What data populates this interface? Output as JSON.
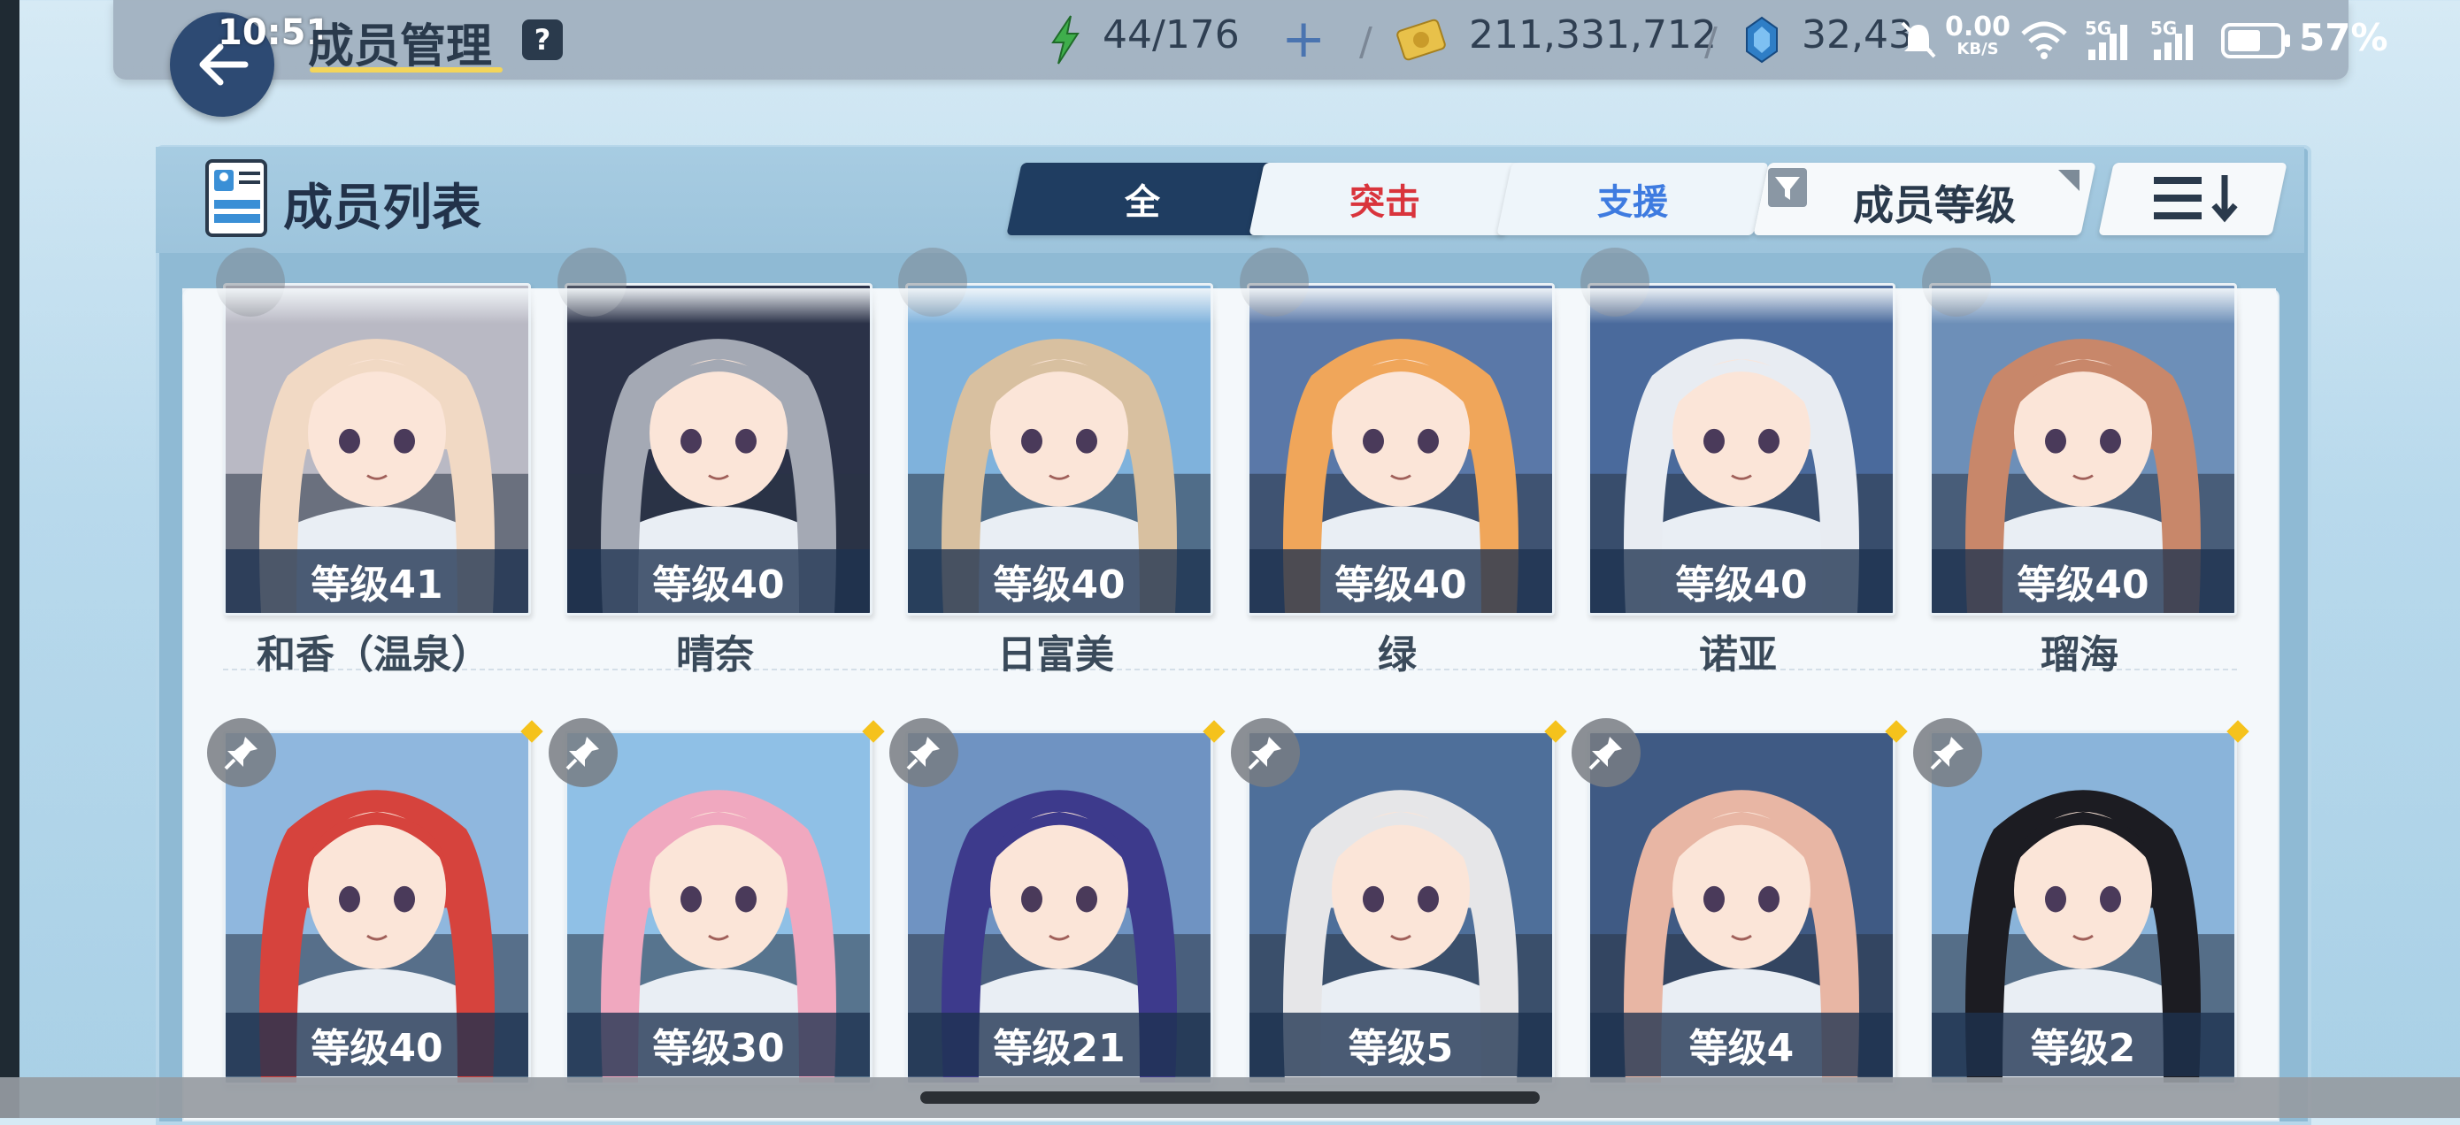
{
  "status_bar": {
    "time": "10:51",
    "net_speed_value": "0.00",
    "net_speed_unit": "KB/S",
    "signal1_label": "5G",
    "signal2_label": "5G",
    "battery": "57%"
  },
  "header": {
    "title": "成员管理",
    "help_label": "?",
    "ap": "44/176",
    "credits": "211,331,712",
    "pyroxene": "32,43"
  },
  "panel": {
    "title": "成员列表",
    "tabs": [
      {
        "label": "全",
        "selected": true
      },
      {
        "label": "突击",
        "color": "#d9343c"
      },
      {
        "label": "支援",
        "color": "#3e7be0"
      }
    ],
    "sort_label": "成员等级"
  },
  "students": [
    {
      "name": "和香（温泉）",
      "level": "等级41",
      "hair": "#f1d9c4",
      "bg": "#b9b9c4"
    },
    {
      "name": "晴奈",
      "level": "等级40",
      "hair": "#a4a9b4",
      "bg": "#2b3248"
    },
    {
      "name": "日富美",
      "level": "等级40",
      "hair": "#d8c0a0",
      "bg": "#7fb2dc"
    },
    {
      "name": "绿",
      "level": "等级40",
      "hair": "#f0a65a",
      "bg": "#5a78a8"
    },
    {
      "name": "诺亚",
      "level": "等级40",
      "hair": "#e8ecf2",
      "bg": "#4a6a9c"
    },
    {
      "name": "瑠海",
      "level": "等级40",
      "hair": "#c8876a",
      "bg": "#6d8fb8"
    },
    {
      "level": "等级40",
      "hair": "#d6433d",
      "bg": "#8fb7de"
    },
    {
      "level": "等级30",
      "hair": "#f0a8bf",
      "bg": "#8fc0e6"
    },
    {
      "level": "等级21",
      "hair": "#3d3a8c",
      "bg": "#6f93c2"
    },
    {
      "level": "等级5",
      "hair": "#e6e6e8",
      "bg": "#4e6f9a"
    },
    {
      "level": "等级4",
      "hair": "#e8b6a4",
      "bg": "#3f5a84"
    },
    {
      "level": "等级2",
      "hair": "#1c1c22",
      "bg": "#8ab4da"
    }
  ]
}
